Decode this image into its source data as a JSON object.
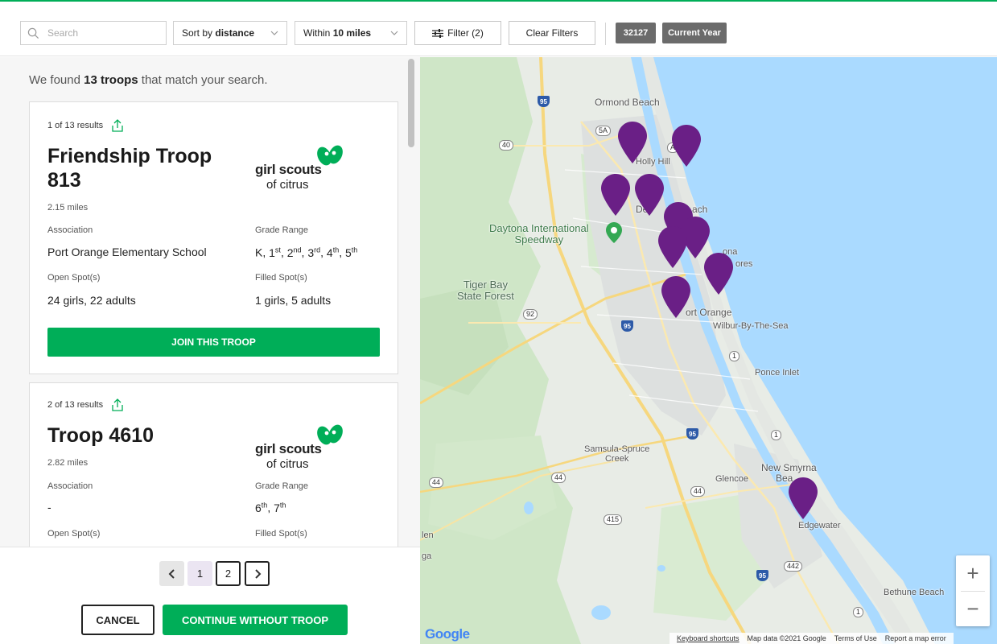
{
  "toolbar": {
    "search_placeholder": "Search",
    "sort": {
      "prefix": "Sort by ",
      "value": "distance"
    },
    "radius": {
      "prefix": "Within ",
      "value": "10 miles"
    },
    "filter_label": "Filter (2)",
    "clear_label": "Clear Filters",
    "chips": [
      "32127",
      "Current Year"
    ]
  },
  "results": {
    "prefix": "We found ",
    "count": "13 troops",
    "suffix": " that match your search."
  },
  "cards": [
    {
      "count_text": "1 of 13 results",
      "title": "Friendship Troop 813",
      "distance": "2.15 miles",
      "logo_line1": "girl scouts",
      "logo_line2": "of citrus",
      "association_label": "Association",
      "association": "Port Orange Elementary School",
      "grade_label": "Grade Range",
      "grades": [
        {
          "n": "K",
          "s": ""
        },
        {
          "n": "1",
          "s": "st"
        },
        {
          "n": "2",
          "s": "nd"
        },
        {
          "n": "3",
          "s": "rd"
        },
        {
          "n": "4",
          "s": "th"
        },
        {
          "n": "5",
          "s": "th"
        }
      ],
      "open_label": "Open Spot(s)",
      "open": "24 girls, 22 adults",
      "filled_label": "Filled Spot(s)",
      "filled": "1 girls, 5 adults",
      "join_label": "JOIN THIS TROOP"
    },
    {
      "count_text": "2 of 13 results",
      "title": "Troop 4610",
      "distance": "2.82 miles",
      "logo_line1": "girl scouts",
      "logo_line2": "of citrus",
      "association_label": "Association",
      "association": "-",
      "grade_label": "Grade Range",
      "grades": [
        {
          "n": "6",
          "s": "th"
        },
        {
          "n": "7",
          "s": "th"
        }
      ],
      "open_label": "Open Spot(s)",
      "filled_label": "Filled Spot(s)"
    }
  ],
  "pagination": {
    "pages": [
      "1",
      "2"
    ],
    "current": "1"
  },
  "footer": {
    "cancel": "CANCEL",
    "continue": "CONTINUE WITHOUT TROOP"
  },
  "map": {
    "places": {
      "ormond": "Ormond Beach",
      "holly": "Holly Hill",
      "daytona_a": "De",
      "daytona_b": "ach",
      "speedway": "Daytona International\nSpeedway",
      "tigerbay": "Tiger Bay\nState Forest",
      "shores_a": "ona",
      "shores_b": "ores",
      "portorange": "ort Orange",
      "wilbur": "Wilbur-By-The-Sea",
      "ponce": "Ponce Inlet",
      "samsula": "Samsula-Spruce\nCreek",
      "newsmyrna": "New Smyrna",
      "beach2": "Bea",
      "glencoe": "Glencoe",
      "edgewater": "Edgewater",
      "bethune": "Bethune Beach",
      "len": "len",
      "ga": "ga"
    },
    "shields": [
      "95",
      "5A",
      "40",
      "A",
      "92",
      "95",
      "1",
      "95",
      "1",
      "44",
      "44",
      "44",
      "415",
      "442",
      "95",
      "1"
    ],
    "zoom_in": "+",
    "zoom_out": "−",
    "google": "Google",
    "attribution": [
      "Keyboard shortcuts",
      "Map data ©2021 Google",
      "Terms of Use",
      "Report a map error"
    ]
  },
  "colors": {
    "accent": "#00ae58",
    "pin": "#6a1f86",
    "water": "#aadaff"
  }
}
